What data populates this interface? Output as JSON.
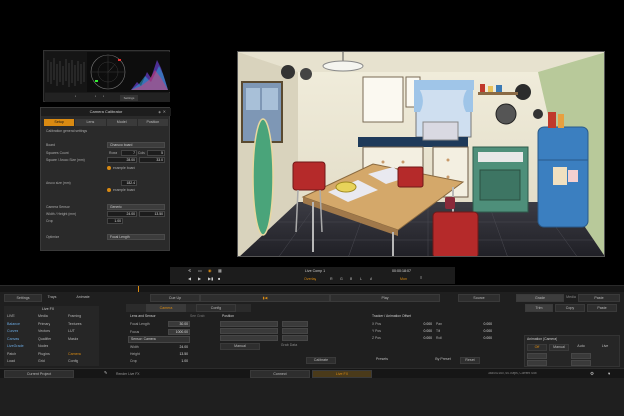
{
  "scopes": {
    "bar_label": "Settings"
  },
  "calibrator": {
    "title": "Camera Calibrator",
    "tabs": [
      {
        "label": "Setup",
        "active": true
      },
      {
        "label": "Lens",
        "active": false
      },
      {
        "label": "Model",
        "active": false
      },
      {
        "label": "Position",
        "active": false
      }
    ],
    "section_title": "Calibration general settings",
    "board_label": "Board",
    "board_value": "Charuco board",
    "squares_count_label": "Squares Count",
    "rows_label": "Rows",
    "rows_value": "7",
    "cols_label": "Cols",
    "cols_value": "5",
    "square_size_label": "Square / Aruco Size (mm)",
    "square_size_a": "28.00",
    "square_size_b": "33.0",
    "example_board_1": "example board",
    "aruco_size_label": "Aruco size (mm)",
    "aruco_size_value": "182.4",
    "example_board_2": "example board",
    "sensor_label": "Camera Sensor",
    "sensor_value": "Generic",
    "sensor_wh_label": "Width / Height (mm)",
    "sensor_w": "24.00",
    "sensor_h": "13.50",
    "crop_label": "Crop",
    "crop_value": "1.00",
    "optimize_label": "Optimize",
    "optimize_value": "Focal Length"
  },
  "transport": {
    "comp_name": "Live Comp 1",
    "timecode": "00:00:18:07",
    "overlay_label": "Overlay",
    "letters": [
      "R",
      "G",
      "B",
      "L",
      "A"
    ],
    "mon_label": "Mon"
  },
  "toolbar": {
    "settings": "Settings",
    "trays": "Trays",
    "animate": "Animate",
    "cue_up": "Cue Up",
    "play": "Play",
    "source": "Source",
    "grade": "Grade",
    "media": "Media",
    "trim": "Trim",
    "copy": "Copy",
    "paste": "Paste"
  },
  "library": {
    "header": "Live FX",
    "columns": [
      [
        "LIVE",
        "Balance",
        "Curves",
        "Canvas",
        "LiveGrade",
        "Patch",
        "Load"
      ],
      [
        "Media",
        "Primary",
        "Vectors",
        "Qualifier",
        "Nodes",
        "Plugins",
        "Grid"
      ],
      [
        "Framing",
        "Textures",
        "LUT",
        "Masks",
        "",
        "Camera",
        "Config"
      ]
    ]
  },
  "params": {
    "tab_camera": "Camera",
    "tab_config": "Config",
    "lens_header": "Lens and Sensor",
    "lens_sub": "See Grab",
    "focal_label": "Focal Length",
    "focal_value": "30.00",
    "focus_label": "Focus",
    "focus_value": "1000.00",
    "sensor_label": "Sensor: Camera",
    "width_label": "Width",
    "width_value": "24.00",
    "height_label": "Height",
    "height_value": "13.50",
    "crop_label": "Crop",
    "crop_value": "1.00",
    "position_header": "Position",
    "manual_label": "Manual",
    "grab_label": "Grab Data",
    "tracker_header": "Tracker / Animation Offset",
    "xpos": "X Pos",
    "ypos": "Y Pos",
    "zpos": "Z Pos",
    "pan": "Pan",
    "tilt": "Tilt",
    "roll": "Roll",
    "zero": "0.000",
    "calibrate": "Calibrate",
    "presets": "Presets",
    "by_preset": "By Preset",
    "reset": "Reset"
  },
  "animation": {
    "header": "Animation (Camera)",
    "off": "Off",
    "manual": "Manual",
    "auto": "Auto",
    "live": "Live"
  },
  "statusbar": {
    "project": "Current Project",
    "track_label": "Render Live FX",
    "connect": "Connect",
    "live_fx": "Live FX",
    "info": "3840x2160, 60.00fps, Current Slot"
  },
  "colors": {
    "accent": "#d98a12",
    "panel": "#2a2a2a",
    "background": "#000000"
  }
}
